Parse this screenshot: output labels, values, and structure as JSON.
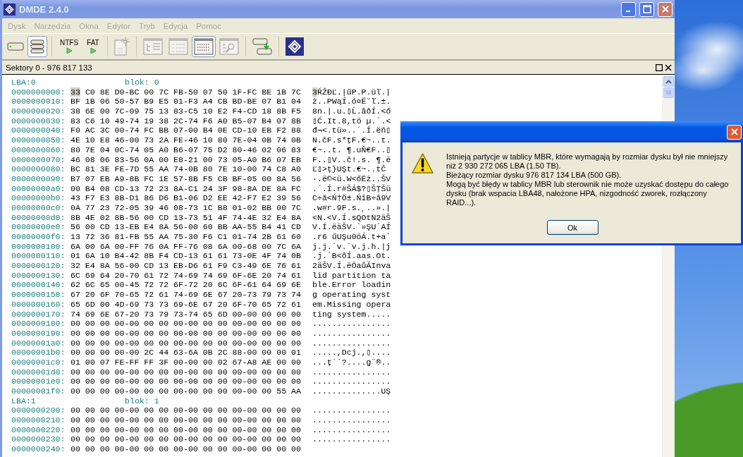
{
  "window": {
    "title": "DMDE 2.4.0"
  },
  "menu": [
    {
      "label": "Dysk",
      "disabled": true
    },
    {
      "label": "Narzędzia",
      "disabled": true
    },
    {
      "label": "Okna",
      "disabled": true
    },
    {
      "label": "Edytor",
      "disabled": true
    },
    {
      "label": "Tryb",
      "disabled": true
    },
    {
      "label": "Edycja",
      "disabled": true
    },
    {
      "label": "Pomoc",
      "disabled": true
    }
  ],
  "toolbar": [
    [
      {
        "kind": "drive",
        "pressed": false
      },
      {
        "kind": "partitions",
        "pressed": true
      }
    ],
    [
      {
        "kind": "ntfs",
        "label": "NTFS",
        "pressed": false
      },
      {
        "kind": "fat",
        "label": "FAT",
        "pressed": false
      }
    ],
    [
      {
        "kind": "newfile",
        "pressed": false
      }
    ],
    [
      {
        "kind": "tree",
        "pressed": false
      },
      {
        "kind": "list",
        "pressed": false
      },
      {
        "kind": "hex",
        "pressed": true
      },
      {
        "kind": "search",
        "pressed": false
      }
    ],
    [
      {
        "kind": "copy",
        "pressed": false
      }
    ],
    [
      {
        "kind": "logo",
        "pressed": false
      }
    ]
  ],
  "panel": {
    "title": "Sektory 0 - 976 817 133"
  },
  "blocks": [
    {
      "lba": "LBA:0",
      "block": "blok: 0",
      "rows": [
        {
          "offset": "0000000000:",
          "hex": "33 C0 8E D0-BC 00 7C FB-50 07 50 1F-FC BE 1B 7C",
          "ascii": "3ŔŽĐĽ.|űP.P.üľ.|",
          "cursor": true
        },
        {
          "offset": "0000000010:",
          "hex": "BF 1B 06 50-57 B9 E5 01-F3 A4 CB BD-BE 07 B1 04",
          "ascii": "ż..PWąÍ.ó¤Ë˘ľ.±.",
          "cursor": false
        },
        {
          "offset": "0000000020:",
          "hex": "38 6E 00 7C-09 75 13 83-C5 10 E2 F4-CD 18 8B F5",
          "ascii": "8n.|.u.▯Ĺ.âôÍ.<ő",
          "cursor": false
        },
        {
          "offset": "0000000030:",
          "hex": "83 C6 10 49-74 19 38 2C-74 F6 A0 B5-07 B4 07 8B",
          "ascii": "▯Ć.It.8,tö µ.´.<",
          "cursor": false
        },
        {
          "offset": "0000000040:",
          "hex": "F0 AC 3C 00-74 FC BB 07-00 B4 0E CD-10 EB F2 88",
          "ascii": "đ¬<.tü»..´.Í.ëň▯",
          "cursor": false
        },
        {
          "offset": "0000000050:",
          "hex": "4E 10 E8 46-00 73 2A FE-46 10 80 7E-04 0B 74 0B",
          "ascii": "N.čF.s*ţF.€~..t.",
          "cursor": false
        },
        {
          "offset": "0000000060:",
          "hex": "80 7E 04 0C-74 05 A0 B6-07 75 D2 80-46 02 06 83",
          "ascii": "€~..t. ¶.uŇ€F..▯",
          "cursor": false
        },
        {
          "offset": "0000000070:",
          "hex": "46 08 06 83-56 0A 00 E8-21 00 73 05-A0 B6 07 EB",
          "ascii": "F..▯V..č!.s. ¶.ë",
          "cursor": false
        },
        {
          "offset": "0000000080:",
          "hex": "BC 81 3E FE-7D 55 AA 74-0B 80 7E 10-00 74 C8 A0",
          "ascii": "Ľ▯>ţ}UŞt.€~..tČ ",
          "cursor": false
        },
        {
          "offset": "0000000090:",
          "hex": "B7 07 EB A9-8B FC 1E 57-8B F5 CB BF-05 00 8A 56",
          "ascii": "·.ë©<ü.W<őËż..ŠV",
          "cursor": false
        },
        {
          "offset": "00000000a0:",
          "hex": "00 B4 08 CD-13 72 23 8A-C1 24 3F 98-8A DE 8A FC",
          "ascii": ".´.Í.r#ŠÁ$?▯ŠŢŠü",
          "cursor": false
        },
        {
          "offset": "00000000b0:",
          "hex": "43 F7 E3 8B-D1 86 D6 B1-06 D2 EE 42-F7 E2 39 56",
          "ascii": "C÷ă<Ń†Ö±.ŃîB÷â9V",
          "cursor": false
        },
        {
          "offset": "00000000c0:",
          "hex": "0A 77 23 72-05 39 46 08-73 1C B8 01-02 BB 00 7C",
          "ascii": ".w#r.9F.s.¸..».|",
          "cursor": false
        },
        {
          "offset": "00000000d0:",
          "hex": "8B 4E 02 8B-56 00 CD 13-73 51 4F 74-4E 32 E4 8A",
          "ascii": "<N.<V.Í.sQOtN2äŠ",
          "cursor": false
        },
        {
          "offset": "00000000e0:",
          "hex": "56 00 CD 13-EB E4 8A 56-00 60 BB AA-55 B4 41 CD",
          "ascii": "V.Í.ëäŠV.`»ŞU´AÍ",
          "cursor": false
        },
        {
          "offset": "00000000f0:",
          "hex": "13 72 36 81-FB 55 AA 75-30 F6 C1 01-74 2B 61 60",
          "ascii": ".r6 űUŞu0öÁ.t+a`",
          "cursor": false
        },
        {
          "offset": "0000000100:",
          "hex": "6A 00 6A 00-FF 76 0A FF-76 08 6A 00-68 00 7C 6A",
          "ascii": "j.j.˙v.˙v.j.h.|j",
          "cursor": false
        },
        {
          "offset": "0000000110:",
          "hex": "01 6A 10 B4-42 8B F4 CD-13 61 61 73-0E 4F 74 0B",
          "ascii": ".j.´B<ôÍ.aas.Ot.",
          "cursor": false
        },
        {
          "offset": "0000000120:",
          "hex": "32 E4 8A 56-00 CD 13 EB-D6 61 F9 C3-49 6E 76 61",
          "ascii": "2äŠV.Í.ëÖaůĂInva",
          "cursor": false
        },
        {
          "offset": "0000000130:",
          "hex": "6C 69 64 20-70 61 72 74-69 74 69 6F-6E 20 74 61",
          "ascii": "lid partition ta",
          "cursor": false
        },
        {
          "offset": "0000000140:",
          "hex": "62 6C 65 00-45 72 72 6F-72 20 6C 6F-61 64 69 6E",
          "ascii": "ble.Error loadin",
          "cursor": false
        },
        {
          "offset": "0000000150:",
          "hex": "67 20 6F 70-65 72 61 74-69 6E 67 20-73 79 73 74",
          "ascii": "g operating syst",
          "cursor": false
        },
        {
          "offset": "0000000160:",
          "hex": "65 6D 00 4D-69 73 73 69-6E 67 20 6F-70 65 72 61",
          "ascii": "em.Missing opera",
          "cursor": false
        },
        {
          "offset": "0000000170:",
          "hex": "74 69 6E 67-20 73 79 73-74 65 6D 00-00 00 00 00",
          "ascii": "ting system.....",
          "cursor": false
        },
        {
          "offset": "0000000180:",
          "hex": "00 00 00 00-00 00 00 00-00 00 00 00-00 00 00 00",
          "ascii": "................",
          "cursor": false
        },
        {
          "offset": "0000000190:",
          "hex": "00 00 00 00-00 00 00 00-00 00 00 00-00 00 00 00",
          "ascii": "................",
          "cursor": false
        },
        {
          "offset": "00000001a0:",
          "hex": "00 00 00 00-00 00 00 00-00 00 00 00-00 00 00 00",
          "ascii": "................",
          "cursor": false
        },
        {
          "offset": "00000001b0:",
          "hex": "00 00 00 00-00 2C 44 63-6A 0B 2C 88-00 00 00 01",
          "ascii": ".....,Dcj.,▯....",
          "cursor": false
        },
        {
          "offset": "00000001c0:",
          "hex": "01 00 07 FE-FF FF 3F 00-00 00 02 67-A8 AE 00 00",
          "ascii": "...ţ˙˙?....g¨®..",
          "cursor": false
        },
        {
          "offset": "00000001d0:",
          "hex": "00 00 00 00-00 00 00 00-00 00 00 00-00 00 00 00",
          "ascii": "................",
          "cursor": false
        },
        {
          "offset": "00000001e0:",
          "hex": "00 00 00 00-00 00 00 00-00 00 00 00-00 00 00 00",
          "ascii": "................",
          "cursor": false
        },
        {
          "offset": "00000001f0:",
          "hex": "00 00 00 00-00 00 00 00-00 00 00 00-00 00 55 AA",
          "ascii": "..............UŞ",
          "cursor": false
        }
      ]
    },
    {
      "lba": "LBA:1",
      "block": "blok: 1",
      "rows": [
        {
          "offset": "0000000200:",
          "hex": "00 00 00 00-00 00 00 00-00 00 00 00-00 00 00 00",
          "ascii": "................",
          "cursor": false
        },
        {
          "offset": "0000000210:",
          "hex": "00 00 00 00-00 00 00 00-00 00 00 00-00 00 00 00",
          "ascii": "................",
          "cursor": false
        },
        {
          "offset": "0000000220:",
          "hex": "00 00 00 00-00 00 00 00-00 00 00 00-00 00 00 00",
          "ascii": "................",
          "cursor": false
        },
        {
          "offset": "0000000230:",
          "hex": "00 00 00 00-00 00 00 00-00 00 00 00-00 00 00 00",
          "ascii": "................",
          "cursor": false
        },
        {
          "offset": "0000000240:",
          "hex": "00 00 00 00-00 00 00 00-00 00 00 00-00 00 00 00",
          "cursor": false
        }
      ]
    }
  ],
  "dialog": {
    "message": [
      "Istnieją partycje w tablicy MBR, które wymagają by rozmiar dysku był nie mniejszy niż 2 930 272 065 LBA (1.50 TB).",
      "Bieżący rozmiar dysku 976 817 134 LBA (500 GB).",
      "Mogą być błędy w tablicy MBR lub sterownik nie może uzyskać dostępu do całego dysku (brak wspacia LBA48, nałożone HPA, nizgodność zworek, rozłączony RAID...)."
    ],
    "button": "Ok"
  }
}
